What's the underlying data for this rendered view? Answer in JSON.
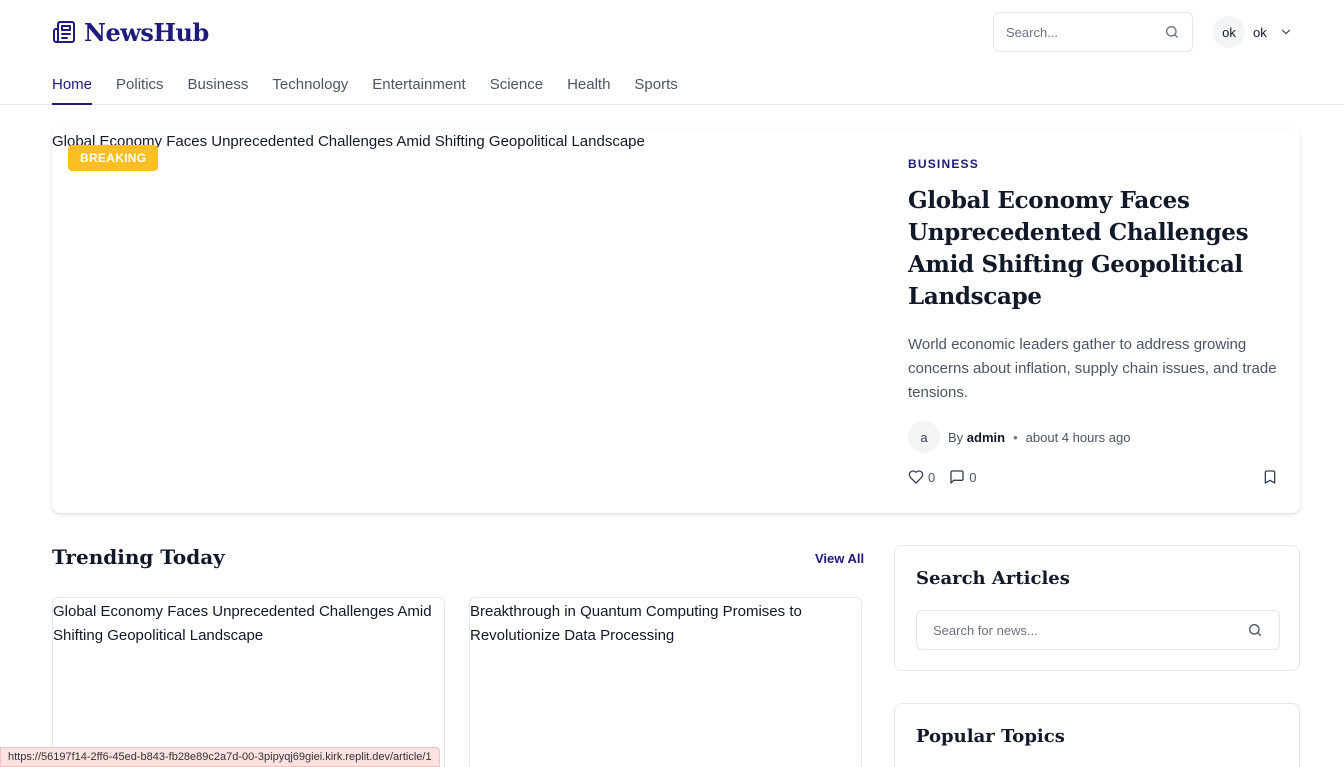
{
  "brand": {
    "name": "NewsHub",
    "color": "#1e1b7a"
  },
  "header": {
    "search_placeholder": "Search...",
    "user": {
      "avatar_initials": "ok",
      "name": "ok"
    }
  },
  "nav": {
    "items": [
      {
        "label": "Home",
        "active": true
      },
      {
        "label": "Politics"
      },
      {
        "label": "Business"
      },
      {
        "label": "Technology"
      },
      {
        "label": "Entertainment"
      },
      {
        "label": "Science"
      },
      {
        "label": "Health"
      },
      {
        "label": "Sports"
      }
    ]
  },
  "featured": {
    "image_alt": "Global Economy Faces Unprecedented Challenges Amid Shifting Geopolitical Landscape",
    "badge": "BREAKING",
    "badge_color": "#fbbf24",
    "category": "BUSINESS",
    "title": "Global Economy Faces Unprecedented Challenges Amid Shifting Geopolitical Landscape",
    "summary": "World economic leaders gather to address growing concerns about inflation, supply chain issues, and trade tensions.",
    "author_initial": "a",
    "by_prefix": "By",
    "author": "admin",
    "time": "about 4 hours ago",
    "likes": "0",
    "comments": "0"
  },
  "trending": {
    "title": "Trending Today",
    "view_all": "View All",
    "cards": [
      {
        "image_alt": "Global Economy Faces Unprecedented Challenges Amid Shifting Geopolitical Landscape"
      },
      {
        "image_alt": "Breakthrough in Quantum Computing Promises to Revolutionize Data Processing"
      }
    ]
  },
  "sidebar": {
    "search": {
      "title": "Search Articles",
      "placeholder": "Search for news..."
    },
    "popular": {
      "title": "Popular Topics"
    }
  },
  "status_bar": {
    "url": "https://56197f14-2ff6-45ed-b843-fb28e89c2a7d-00-3pipyqj69giei.kirk.replit.dev/article/1"
  }
}
